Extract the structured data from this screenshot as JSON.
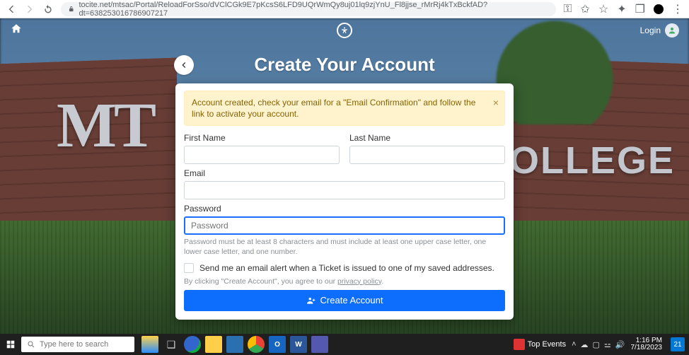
{
  "browser": {
    "url": "tocite.net/mtsac/Portal/ReloadForSso/dVClCGk9E7pKcsS6LFD9UQrWmQy8uj01lq9zjYnU_Fl8jjse_rMrRj4kTxBckfAD?dt=638253016786907217"
  },
  "site": {
    "login_label": "Login",
    "bg_left_text": "MT",
    "bg_right_text": "O COLLEGE"
  },
  "heading": "Create Your Account",
  "alert": {
    "text": "Account created, check your email for a \"Email Confirmation\" and follow the link to activate your account."
  },
  "form": {
    "first_name_label": "First Name",
    "last_name_label": "Last Name",
    "email_label": "Email",
    "password_label": "Password",
    "password_placeholder": "Password",
    "password_hint": "Password must be at least 8 characters and must include at least one upper case letter, one lower case letter, and one number.",
    "checkbox_label": "Send me an email alert when a Ticket is issued to one of my saved addresses.",
    "agree_prefix": "By clicking \"Create Account\", you agree to our ",
    "agree_link": "privacy policy",
    "agree_suffix": ".",
    "submit_label": "Create Account"
  },
  "taskbar": {
    "search_placeholder": "Type here to search",
    "news_label": "Top Events",
    "time": "1:16 PM",
    "date": "7/18/2023",
    "badge": "21"
  }
}
